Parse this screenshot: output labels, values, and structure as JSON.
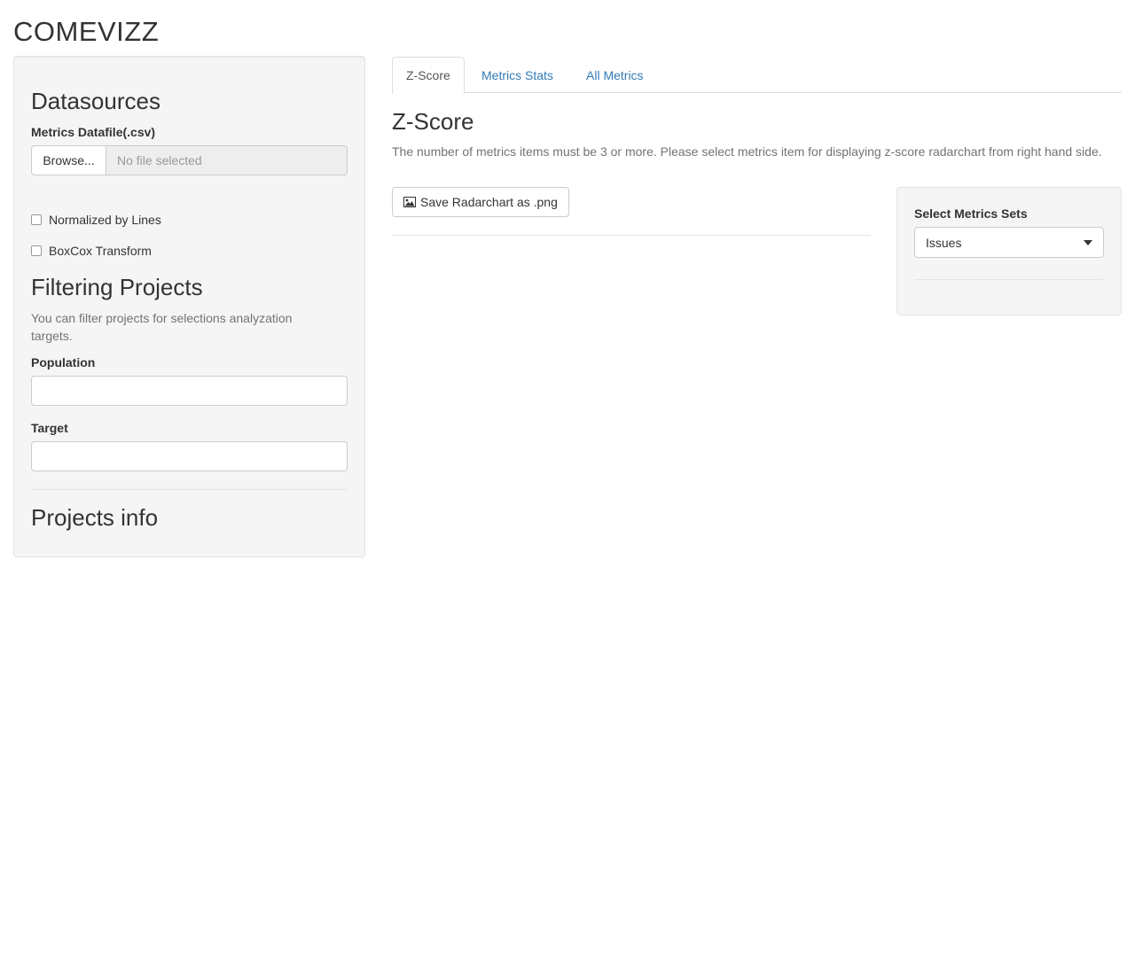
{
  "app": {
    "title": "COMEVIZZ"
  },
  "sidebar": {
    "datasources_heading": "Datasources",
    "metrics_file_label": "Metrics Datafile(.csv)",
    "browse_label": "Browse...",
    "file_placeholder": "No file selected",
    "normalized_label": "Normalized by Lines",
    "boxcox_label": "BoxCox Transform",
    "filtering_heading": "Filtering Projects",
    "filtering_help": "You can filter projects for selections analyzation targets.",
    "population_label": "Population",
    "population_value": "",
    "target_label": "Target",
    "target_value": "",
    "projects_info_heading": "Projects info"
  },
  "tabs": [
    {
      "label": "Z-Score",
      "active": true
    },
    {
      "label": "Metrics Stats",
      "active": false
    },
    {
      "label": "All Metrics",
      "active": false
    }
  ],
  "main": {
    "title": "Z-Score",
    "description": "The number of metrics items must be 3 or more. Please select metrics item for displaying z-score radarchart from right hand side.",
    "save_button_label": "Save Radarchart as .png",
    "save_button_icon": "picture-icon"
  },
  "metrics_panel": {
    "label": "Select Metrics Sets",
    "selected": "Issues"
  },
  "colors": {
    "link": "#337ab7",
    "well_bg": "#f5f5f5",
    "muted_text": "#737373"
  }
}
